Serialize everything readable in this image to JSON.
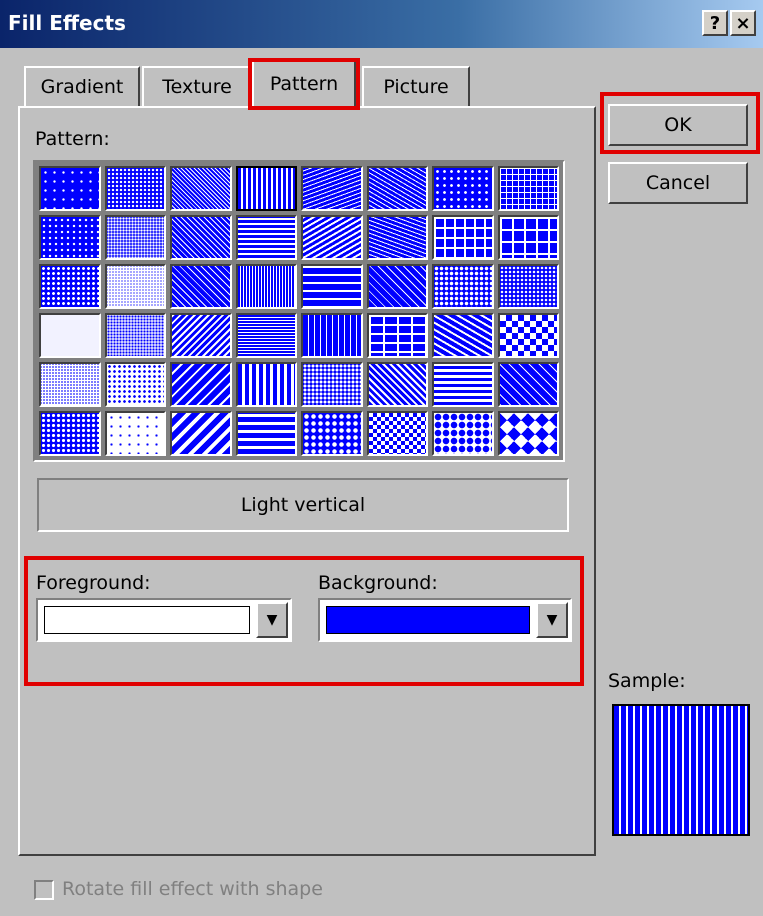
{
  "window": {
    "title": "Fill Effects",
    "help_button": "?",
    "close_button": "×"
  },
  "tabs": [
    {
      "label": "Gradient"
    },
    {
      "label": "Texture"
    },
    {
      "label": "Pattern"
    },
    {
      "label": "Picture"
    }
  ],
  "active_tab": "Pattern",
  "pattern_section": {
    "label": "Pattern:",
    "selected_index": 3,
    "selected_name": "Light vertical",
    "patterns": [
      "5% ",
      "10%",
      "Light downward diagonal",
      "Light vertical",
      "Dashed downward diagonal",
      "Zig zag",
      "Confetti",
      "Small grid",
      "20%",
      "25%",
      "Dark downward diagonal",
      "Light horizontal",
      "Dashed upward diagonal",
      "Wave",
      "Large confetti",
      "Large grid",
      "30%",
      "40%",
      "Wide downward diagonal",
      "Narrow vertical",
      "Dashed horizontal",
      "Diagonal brick",
      "Small confetti",
      "Dotted grid",
      "50%",
      "60%",
      "Light upward diagonal",
      "Narrow horizontal",
      "Dashed vertical",
      "Horizontal brick",
      "Weave",
      "Small checkerboard",
      "70%",
      "75%",
      "Dark upward diagonal",
      "Dark vertical",
      "Small confetti dots",
      "Plaid",
      "Shingle",
      "Outlined diamond",
      "80%",
      "90%",
      "Wide upward diagonal",
      "Dark horizontal",
      "Large confetti dots",
      "Divot",
      "Sphere",
      "Solid diamond"
    ]
  },
  "foreground": {
    "label": "Foreground:",
    "color": "#ffffff"
  },
  "background": {
    "label": "Background:",
    "color": "#0000ff"
  },
  "buttons": {
    "ok": "OK",
    "cancel": "Cancel"
  },
  "sample": {
    "label": "Sample:"
  },
  "rotate_checkbox": {
    "label": "Rotate fill effect with shape",
    "checked": false,
    "enabled": false
  },
  "colors": {
    "pattern_fg": "#0000ff",
    "pattern_bg": "#ffffff",
    "highlight": "#e00000"
  }
}
